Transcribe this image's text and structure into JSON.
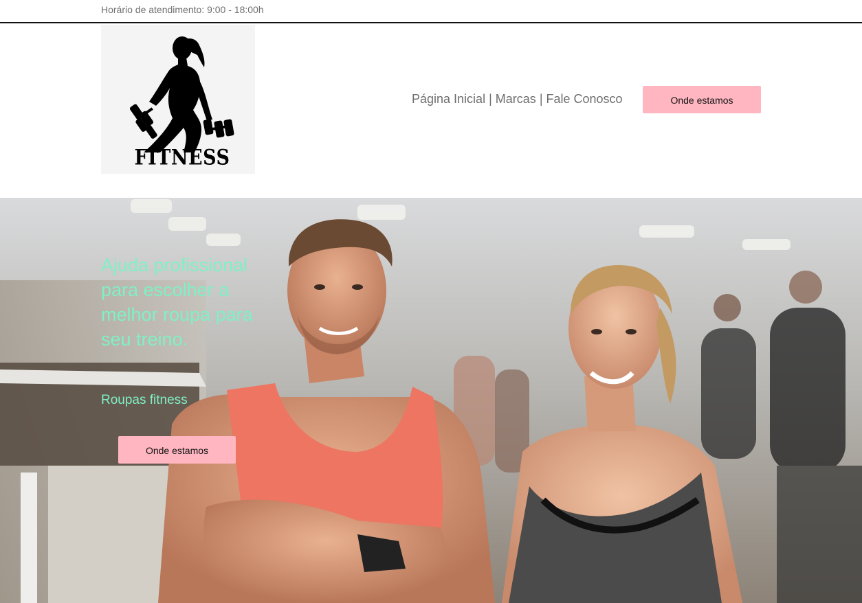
{
  "topbar": {
    "hours": "Horário de atendimento: 9:00 - 18:00h"
  },
  "header": {
    "logo_text": "FITNESS",
    "logo_icon": "fitness-woman-dumbbells-icon",
    "nav": {
      "home": "Página Inicial",
      "brands": "Marcas",
      "contact": "Fale Conosco",
      "separator": "|"
    },
    "cta_label": "Onde estamos"
  },
  "hero": {
    "title": "Ajuda profissional para escolher a melhor roupa para seu treino.",
    "subtitle": "Roupas fitness",
    "cta_label": "Onde estamos",
    "image": "gym-couple-photo"
  },
  "colors": {
    "accent_pink": "#ffb6c1",
    "hero_text": "#7ff0c6",
    "nav_text": "#6e6e6e"
  }
}
